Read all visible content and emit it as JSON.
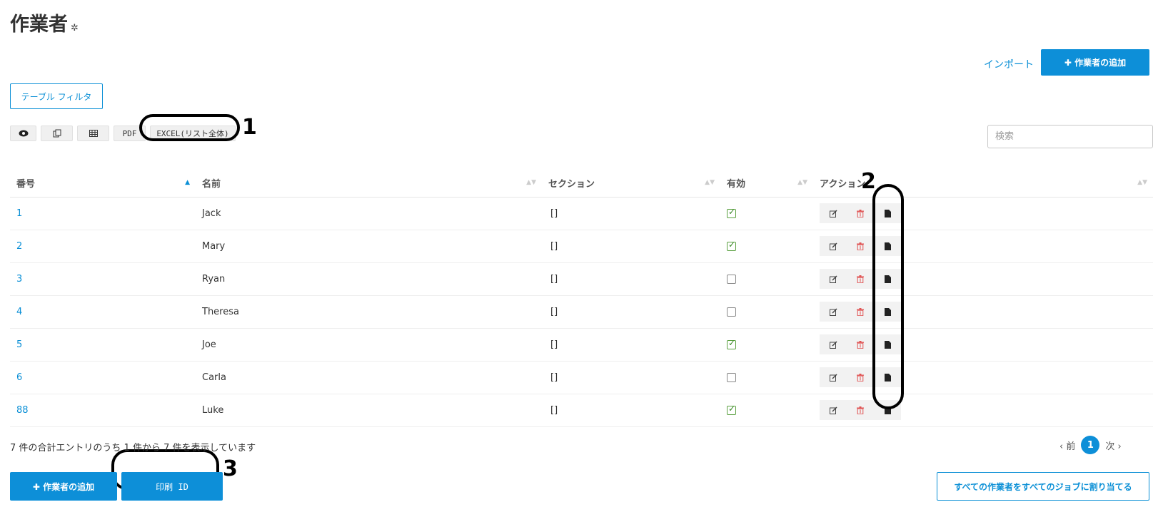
{
  "header": {
    "title": "作業者",
    "import_label": "インポート",
    "add_worker_label": "✚ 作業者の追加"
  },
  "filters": {
    "table_filter_label": "テーブル フィルタ",
    "pdf_label": "PDF",
    "excel_label": "EXCEL(リスト全体)",
    "search_placeholder": "検索"
  },
  "table": {
    "columns": [
      "番号",
      "名前",
      "セクション",
      "有効",
      "アクション"
    ],
    "sorted_column": "番号",
    "rows": [
      {
        "id": "1",
        "name": "Jack",
        "section": "[]",
        "active": true
      },
      {
        "id": "2",
        "name": "Mary",
        "section": "[]",
        "active": true
      },
      {
        "id": "3",
        "name": "Ryan",
        "section": "[]",
        "active": false
      },
      {
        "id": "4",
        "name": "Theresa",
        "section": "[]",
        "active": false
      },
      {
        "id": "5",
        "name": "Joe",
        "section": "[]",
        "active": true
      },
      {
        "id": "6",
        "name": "Carla",
        "section": "[]",
        "active": false
      },
      {
        "id": "88",
        "name": "Luke",
        "section": "[]",
        "active": true
      }
    ],
    "row_action_icons": [
      "edit-icon",
      "trash-icon",
      "document-icon"
    ]
  },
  "footer": {
    "info": "7 件の合計エントリのうち 1 件から 7 件を表示しています",
    "prev_label": "‹ 前",
    "current_page": "1",
    "next_label": "次 ›",
    "add_worker_label": "✚ 作業者の追加",
    "print_id_label": "印刷 ID",
    "assign_all_label": "すべての作業者をすべてのジョブに割り当てる"
  },
  "annotations": [
    "1",
    "2",
    "3"
  ],
  "colors": {
    "primary": "#0d8fd8",
    "check_green": "#3c8a2a",
    "delete_red": "#e05353"
  }
}
